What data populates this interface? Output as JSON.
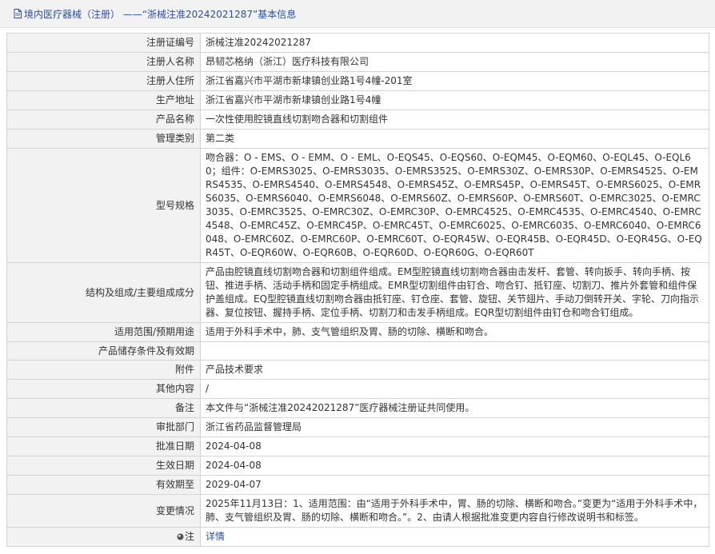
{
  "header": {
    "title": "境内医疗器械（注册） ——“浙械注准20242021287”基本信息"
  },
  "rows": [
    {
      "label": "注册证编号",
      "value": "浙械注准20242021287"
    },
    {
      "label": "注册人名称",
      "value": "昂韧芯格纳（浙江）医疗科技有限公司"
    },
    {
      "label": "注册人住所",
      "value": "浙江省嘉兴市平湖市新埭镇创业路1号4幢-201室"
    },
    {
      "label": "生产地址",
      "value": "浙江省嘉兴市平湖市新埭镇创业路1号4幢"
    },
    {
      "label": "产品名称",
      "value": "一次性使用腔镜直线切割吻合器和切割组件"
    },
    {
      "label": "管理类别",
      "value": "第二类"
    },
    {
      "label": "型号规格",
      "value": "吻合器：O - EMS、O - EMM、O - EML、O-EQS45、O-EQS60、O-EQM45、O-EQM60、O-EQL45、O-EQL60；组件：O-EMRS3025、O-EMRS3035、O-EMRS3525、O-EMRS30Z、O-EMRS30P、O-EMRS4525、O-EMRS4535、O-EMRS4540、O-EMRS4548、O-EMRS45Z、O-EMRS45P、O-EMRS45T、O-EMRS6025、O-EMRS6035、O-EMRS6040、O-EMRS6048、O-EMRS60Z、O-EMRS60P、O-EMRS60T、O-EMRC3025、O-EMRC3035、O-EMRC3525、O-EMRC30Z、O-EMRC30P、O-EMRC4525、O-EMRC4535、O-EMRC4540、O-EMRC4548、O-EMRC45Z、O-EMRC45P、O-EMRC45T、O-EMRC6025、O-EMRC6035、O-EMRC6040、O-EMRC6048、O-EMRC60Z、O-EMRC60P、O-EMRC60T、O-EQR45W、O-EQR45B、O-EQR45D、O-EQR45G、O-EQR45T、O-EQR60W、O-EQR60B、O-EQR60D、O-EQR60G、O-EQR60T"
    },
    {
      "label": "结构及组成/主要组成成分",
      "value": "产品由腔镜直线切割吻合器和切割组件组成。EM型腔镜直线切割吻合器由击发杆、套管、转向扳手、转向手柄、按钮、推进手柄、活动手柄和固定手柄组成。EMR型切割组件由钉合、吻合钉、抵钉座、切割刀、推片外套管和组件保护盖组成。EQ型腔镜直线切割吻合器由抵钉座、钉仓座、套管、旋钮、关节翅片、手动刀倒转开关、字轮、刀向指示器、复位按钮、握持手柄、定位手柄、切割刀和击发手柄组成。EQR型切割组件由钉仓和吻合钉组成。"
    },
    {
      "label": "适用范围/预期用途",
      "value": "适用于外科手术中，肺、支气管组织及胃、肠的切除、横断和吻合。"
    },
    {
      "label": "产品储存条件及有效期",
      "value": ""
    },
    {
      "label": "附件",
      "value": "产品技术要求"
    },
    {
      "label": "其他内容",
      "value": "/"
    },
    {
      "label": "备注",
      "value": "本文件与“浙械注准20242021287”医疗器械注册证共同使用。"
    },
    {
      "label": "审批部门",
      "value": "浙江省药品监督管理局"
    },
    {
      "label": "批准日期",
      "value": "2024-04-08"
    },
    {
      "label": "生效日期",
      "value": "2024-04-08"
    },
    {
      "label": "有效期至",
      "value": "2029-04-07"
    },
    {
      "label": "变更情况",
      "value": "2025年11月13日：1、适用范围：由“适用于外科手术中，胃、肠的切除、横断和吻合。”变更为“适用于外科手术中，肺、支气管组织及胃、肠的切除、横断和吻合。”。2、由请人根据批准变更内容自行修改说明书和标签。"
    }
  ],
  "note_row": {
    "label": "注",
    "link": "详情",
    "icon": "map-pin-icon"
  }
}
